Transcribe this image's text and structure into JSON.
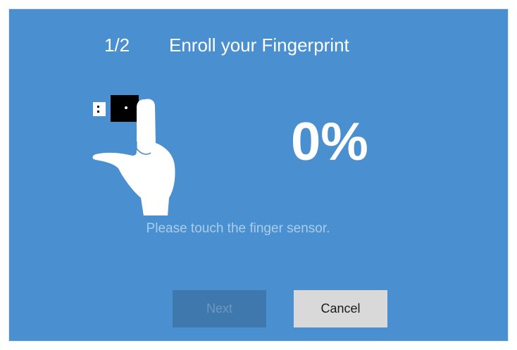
{
  "wizard": {
    "step": "1/2",
    "title": "Enroll your Fingerprint",
    "progress_text": "0%",
    "status": "Please touch the finger sensor."
  },
  "buttons": {
    "next_label": "Next",
    "cancel_label": "Cancel"
  },
  "illustration": {
    "icon": "finger-on-usb-sensor-icon"
  },
  "colors": {
    "background": "#4a8fcf",
    "text": "#ffffff",
    "status_text": "#a9cdeb",
    "next_button_bg": "#3f78ad",
    "cancel_button_bg": "#d9d9d9"
  }
}
